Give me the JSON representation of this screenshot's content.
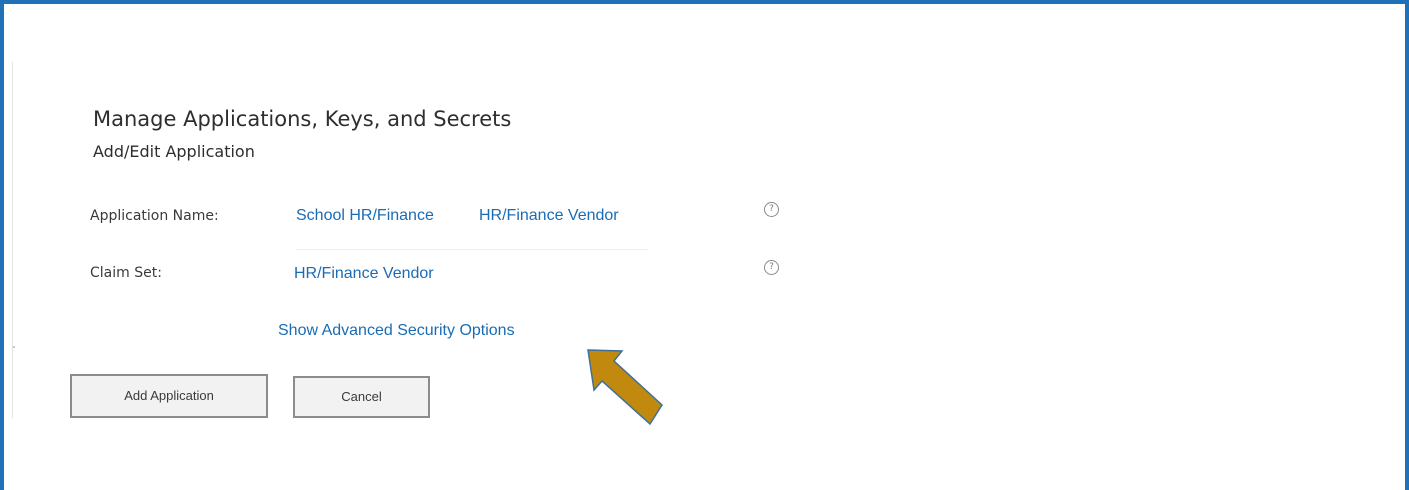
{
  "page": {
    "title": "Manage Applications, Keys, and Secrets",
    "subtitle": "Add/Edit Application"
  },
  "form": {
    "application_name": {
      "label": "Application Name:",
      "value_1": "School HR/Finance",
      "value_2": "HR/Finance Vendor",
      "help_icon": "question-circle"
    },
    "claim_set": {
      "label": "Claim Set:",
      "value": "HR/Finance Vendor",
      "help_icon": "question-circle"
    },
    "advanced_link": "Show Advanced Security Options"
  },
  "buttons": {
    "add_label": "Add Application",
    "cancel_label": "Cancel"
  },
  "colors": {
    "frame_border": "#1f72b8",
    "link": "#1a6cb5",
    "arrow_fill": "#c18a0e",
    "arrow_stroke": "#3f6f9b"
  }
}
